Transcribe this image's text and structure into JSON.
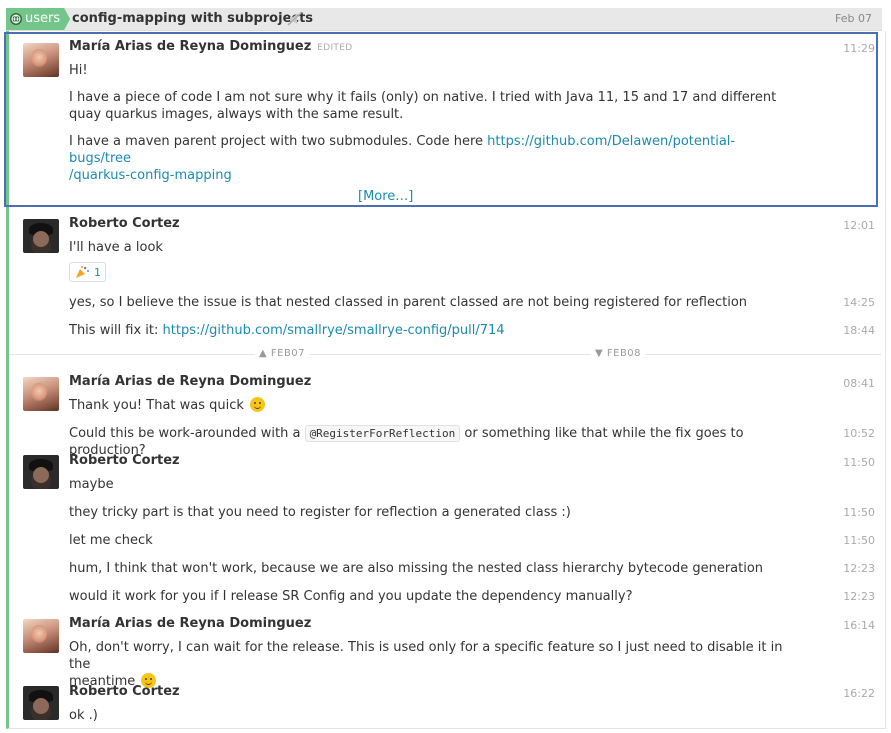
{
  "header": {
    "room": "users",
    "thread_title": "config-mapping with subprojects",
    "date": "Feb 07",
    "accent": "#74c58a"
  },
  "messages": [
    {
      "author": "María Arias de Reyna Dominguez",
      "edited": "EDITED",
      "time": "11:29",
      "lines": [
        "Hi!",
        "I have a piece of code I am not sure why it fails (only) on native. I tried with Java 11, 15 and 17 and different quay quarkus images, always with the same result.",
        "I have a maven parent project with two submodules. Code here "
      ],
      "link": "https://github.com/Delawen/potential-bugs/tree/quarkus-config-mapping",
      "link_line1": "https://github.com/Delawen/potential-bugs/tree",
      "link_line2": "/quarkus-config-mapping",
      "more": "[More…]"
    },
    {
      "author": "Roberto Cortez",
      "time": "12:01",
      "text": "I'll have a look",
      "reaction_count": "1"
    },
    {
      "time": "14:25",
      "text": "yes, so I believe the issue is that nested classed in parent classed are not being registered for reflection"
    },
    {
      "time": "18:44",
      "text": "This will fix it: ",
      "link": "https://github.com/smallrye/smallrye-config/pull/714"
    },
    {
      "author": "María Arias de Reyna Dominguez",
      "time": "08:41",
      "text": "Thank you! That was quick"
    },
    {
      "time": "10:52",
      "text_before": "Could this be work-arounded with a ",
      "code": "@RegisterForReflection",
      "text_after": " or something like that while the fix goes to production?"
    },
    {
      "author": "Roberto Cortez",
      "time": "11:50",
      "text": "maybe"
    },
    {
      "time": "11:50",
      "text": "they tricky part is that you need to register for reflection a generated class :)"
    },
    {
      "time": "11:50",
      "text": "let me check"
    },
    {
      "time": "12:23",
      "text": "hum, I think that won't work, because we are also missing the nested class hierarchy bytecode generation"
    },
    {
      "time": "12:23",
      "text": "would it work for you if I release SR Config and you update the dependency manually?"
    },
    {
      "author": "María Arias de Reyna Dominguez",
      "time": "16:14",
      "text1": "Oh, don't worry, I can wait for the release. This is used only for a specific feature so I just need to disable it in the",
      "text2": "meantime"
    },
    {
      "author": "Roberto Cortez",
      "time": "16:22",
      "text": "ok .)"
    }
  ],
  "day_divider": {
    "prev": "FEB07",
    "next": "FEB08"
  }
}
